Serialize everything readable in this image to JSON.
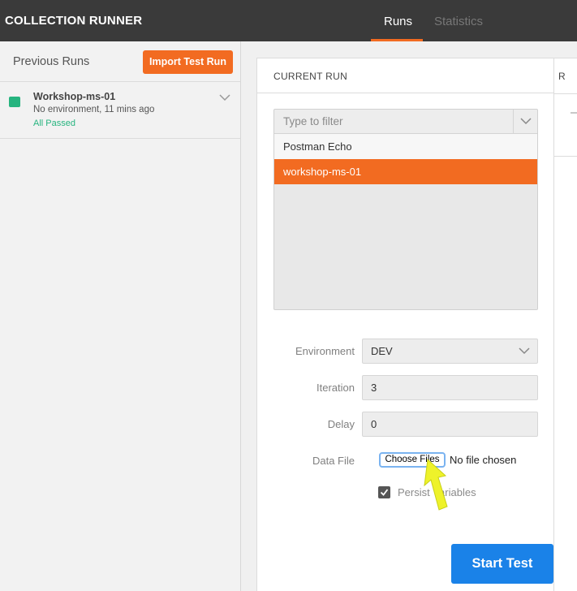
{
  "app": {
    "title": "COLLECTION RUNNER"
  },
  "tabs": [
    {
      "label": "Runs",
      "active": true
    },
    {
      "label": "Statistics",
      "active": false
    }
  ],
  "sidebar": {
    "heading": "Previous Runs",
    "import_button": "Import Test Run",
    "runs": [
      {
        "name": "Workshop-ms-01",
        "meta": "No environment, 11 mins ago",
        "result": "All Passed",
        "status_color": "#26b47f"
      }
    ]
  },
  "current_run": {
    "title": "CURRENT RUN",
    "filter_placeholder": "Type to filter",
    "collections": [
      {
        "name": "Postman Echo",
        "selected": false
      },
      {
        "name": "workshop-ms-01",
        "selected": true
      }
    ],
    "environment": {
      "label": "Environment",
      "value": "DEV"
    },
    "iteration": {
      "label": "Iteration",
      "value": "3"
    },
    "delay": {
      "label": "Delay",
      "value": "0"
    },
    "data_file": {
      "label": "Data File",
      "button": "Choose Files",
      "status": "No file chosen"
    },
    "persist": {
      "label": "Persist Variables",
      "checked": true
    },
    "start_button": "Start Test"
  },
  "results_panel": {
    "title_fragment": "R"
  },
  "colors": {
    "accent": "#f26b21",
    "primary": "#1a82e8",
    "success": "#26b47f",
    "topbar": "#3a3a3a"
  }
}
